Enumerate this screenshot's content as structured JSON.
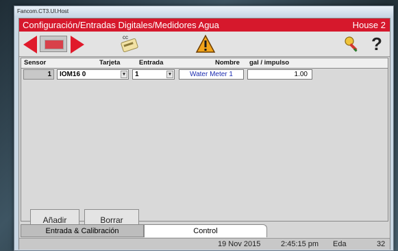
{
  "window": {
    "title": "Fancom.CT3.UI.Host"
  },
  "header": {
    "title": "Configuración/Entradas Digitales/Medidores Agua",
    "house": "House 2"
  },
  "toolbar": {
    "cc_label": "cc",
    "help_label": "?"
  },
  "table": {
    "columns": [
      "Sensor",
      "Tarjeta",
      "Entrada",
      "Nombre",
      "gal / impulso"
    ],
    "rows": [
      {
        "sensor": "1",
        "tarjeta": "IOM16 0",
        "entrada": "1",
        "nombre": "Water Meter 1",
        "gal_impulso": "1.00"
      }
    ]
  },
  "buttons": {
    "add": "Añadir",
    "delete": "Borrar"
  },
  "tabs": [
    {
      "label": "Entrada & Calibración"
    },
    {
      "label": "Control"
    }
  ],
  "status": {
    "date": "19 Nov 2015",
    "time": "2:45:15 pm",
    "user": "Eda",
    "number": "32"
  },
  "colors": {
    "header_red": "#d6182c",
    "nav_red": "#e01a2b",
    "name_blue": "#1a2bb0"
  }
}
